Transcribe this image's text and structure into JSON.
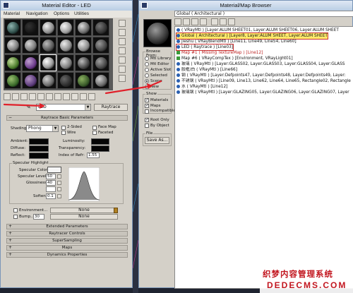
{
  "material_editor": {
    "title": "Material Editor - LED",
    "menu": [
      "Material",
      "Navigation",
      "Options",
      "Utilities"
    ],
    "material_name": "LED",
    "material_type": "Raytrace",
    "rollouts": {
      "basic_params_title": "Raytrace Basic Parameters",
      "extended": "Extended Parameters",
      "raytracer_controls": "Raytracer Controls",
      "supersampling": "SuperSampling",
      "maps": "Maps",
      "dynamics": "Dynamics Properties"
    },
    "basic": {
      "shading_label": "Shading:",
      "shading_value": "Phong",
      "two_sided": "2-Sided",
      "wire": "Wire",
      "face_map": "Face Map",
      "faceted": "Faceted",
      "ambient": "Ambient:",
      "diffuse": "Diffuse:",
      "reflect": "Reflect:",
      "luminosity": "Luminosity:",
      "transparency": "Transparency:",
      "ior_label": "Index of Refr:",
      "ior_value": "1.55"
    },
    "specular": {
      "title": "Specular Highlight",
      "color_label": "Specular Color",
      "level_label": "Specular Level:",
      "level_value": "50",
      "gloss_label": "Glossiness:",
      "gloss_value": "40",
      "soften_label": "Soften",
      "soften_value": "0.1"
    },
    "environment_label": "Environment...",
    "environment_value": "None",
    "bump_label": "Bump...........",
    "bump_amount": "30",
    "bump_value": "None"
  },
  "browser": {
    "title": "Material/Map Browser",
    "name_field": "Global  ( Architectural )",
    "browse_from": {
      "title": "Browse From:",
      "options": [
        "Mtl Library",
        "Mtl Editor",
        "Active Slot",
        "Selected",
        "Scene",
        "New"
      ]
    },
    "show": {
      "title": "Show",
      "options": [
        "Materials",
        "Maps",
        "Incompatible"
      ]
    },
    "root_only": "Root Only",
    "by_object": "By Object",
    "file_title": "File",
    "save_as": "Save As...",
    "items": [
      "( VRayMtl ) [Layer:ALUM SHEET01, Layer:ALUM SHEET06, Layer:ALUM SHEET",
      "Global  ( Architectural )  [Layer8, Layer:ALUM SHEET, Layer:ALUM SHEET",
      "jieshu  ( VRayBlendMtl )  [Line11, Line49, Line54, Line60]",
      "LED  ( Raytrace )  [Line03]",
      "Map #1  ( Missing TextureMap )  [Line12]",
      "Map #6  ( VRayCompTex )  [Environment, VRayLight01]",
      "玻璃  ( VRayMtl )  [Layer:GLASS02, Layer:GLASS03, Layer:GLASS04, Layer:GLASS",
      "胶框/白  ( VRayMtl )  [Line66]",
      "钢  ( VRayMtl )  [Layer:Defpoints47, Layer:Defpoints48, Layer:Defpoints49, Layer:",
      "不锈钢  ( VRayMtl )  [Line09, Line13, Line62, Line64, Line65, Rectangle02, Rectangle",
      "水  ( VRayMtl )  [Line12]",
      "玻璃钢  ( VRayMtl )  [Layer:GLAZING05, Layer:GLAZING06, Layer:GLAZING07, Layer"
    ]
  },
  "watermark": {
    "cn": "织梦内容管理系统",
    "en": "DEDECMS.COM"
  }
}
